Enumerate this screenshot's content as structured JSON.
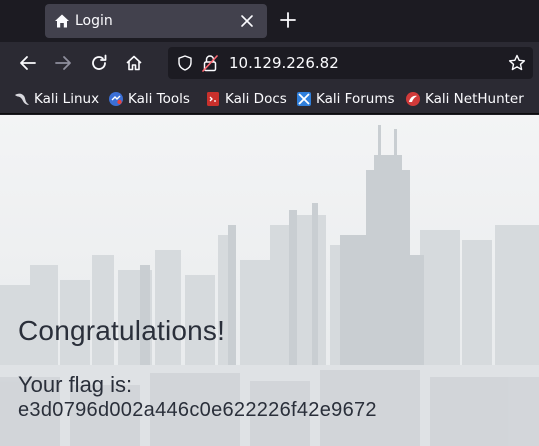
{
  "browser": {
    "tab": {
      "title": "Login",
      "icon": "home-icon"
    },
    "address": {
      "url": "10.129.226.82"
    },
    "bookmarks": [
      {
        "label": "Kali Linux",
        "icon": "kali-dragon-icon"
      },
      {
        "label": "Kali Tools",
        "icon": "kali-tools-icon"
      },
      {
        "label": "Kali Docs",
        "icon": "kali-docs-icon"
      },
      {
        "label": "Kali Forums",
        "icon": "kali-forums-icon"
      },
      {
        "label": "Kali NetHunter",
        "icon": "kali-nethunter-icon"
      }
    ]
  },
  "page": {
    "heading": "Congratulations!",
    "flag_label": "Your flag is:",
    "flag_value": "e3d0796d002a446c0e622226f42e9672"
  }
}
